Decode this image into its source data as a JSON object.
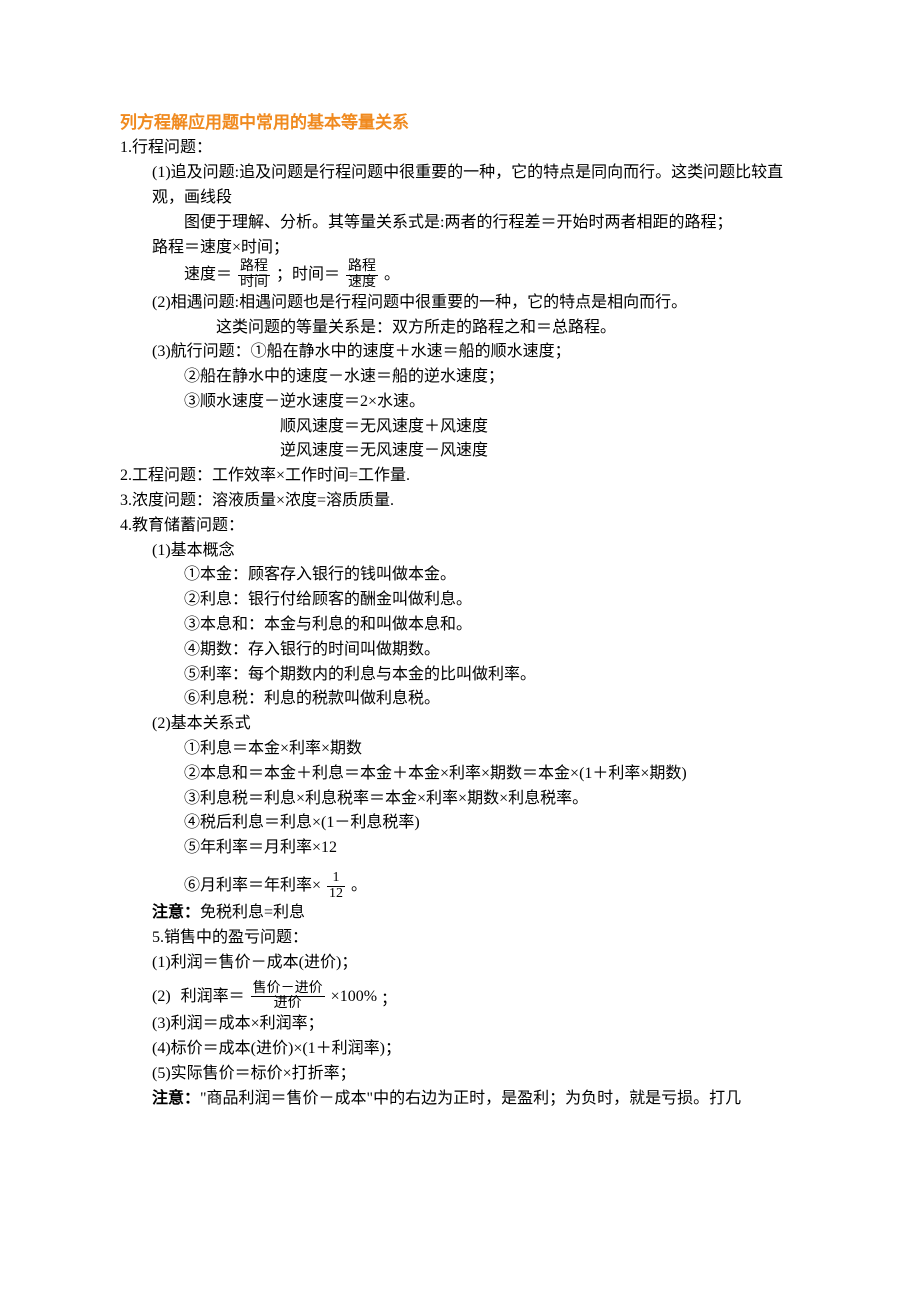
{
  "title": "列方程解应用题中常用的基本等量关系",
  "s1": {
    "h": "1.行程问题：",
    "p1a": "(1)追及问题:追及问题是行程问题中很重要的一种，它的特点是同向而行。这类问题比较直观，画线段",
    "p1b": "图便于理解、分析。其等量关系式是:两者的行程差＝开始时两者相距的路程；",
    "p1c": "路程＝速度×时间；",
    "p1d_pre": "速度＝",
    "p1d_num": "路程",
    "p1d_den": "时间",
    "p1d_mid": "；时间＝",
    "p1d_num2": "路程",
    "p1d_den2": "速度",
    "p1d_end": "。",
    "p2a": "(2)相遇问题:相遇问题也是行程问题中很重要的一种，它的特点是相向而行。",
    "p2b": "这类问题的等量关系是：双方所走的路程之和＝总路程。",
    "p3a": "(3)航行问题：①船在静水中的速度＋水速＝船的顺水速度；",
    "p3b": "②船在静水中的速度－水速＝船的逆水速度；",
    "p3c": "③顺水速度－逆水速度＝2×水速。",
    "p3d": "顺风速度＝无风速度＋风速度",
    "p3e": "逆风速度＝无风速度－风速度"
  },
  "s2": "2.工程问题：工作效率×工作时间=工作量.",
  "s3": "3.浓度问题：溶液质量×浓度=溶质质量.",
  "s4": {
    "h": "4.教育储蓄问题：",
    "a": "(1)基本概念",
    "a1": "①本金：顾客存入银行的钱叫做本金。",
    "a2": "②利息：银行付给顾客的酬金叫做利息。",
    "a3": "③本息和：本金与利息的和叫做本息和。",
    "a4": "④期数：存入银行的时间叫做期数。",
    "a5": "⑤利率：每个期数内的利息与本金的比叫做利率。",
    "a6": "⑥利息税：利息的税款叫做利息税。",
    "b": "(2)基本关系式",
    "b1": "①利息＝本金×利率×期数",
    "b2": "②本息和＝本金＋利息＝本金＋本金×利率×期数＝本金×(1＋利率×期数)",
    "b3": "③利息税＝利息×利息税率＝本金×利率×期数×利息税率。",
    "b4": "④税后利息＝利息×(1－利息税率)",
    "b5": "⑤年利率＝月利率×12",
    "b6_pre": "⑥月利率＝年利率×",
    "b6_num": "1",
    "b6_den": "12",
    "b6_end": "。",
    "note_label": "注意：",
    "note_text": "免税利息=利息"
  },
  "s5": {
    "h": "5.销售中的盈亏问题：",
    "p1": "(1)利润＝售价－成本(进价)；",
    "p2_pre": "(2)",
    "p2_lhs": "利润率＝",
    "p2_num": "售价－进价",
    "p2_den": "进价",
    "p2_tail": "×100%",
    "p2_end": "；",
    "p3": "(3)利润＝成本×利润率；",
    "p4": "(4)标价＝成本(进价)×(1＋利润率)；",
    "p5": "(5)实际售价＝标价×打折率；",
    "note_label": "注意：",
    "note_text": "\"商品利润＝售价－成本\"中的右边为正时，是盈利；为负时，就是亏损。打几"
  }
}
